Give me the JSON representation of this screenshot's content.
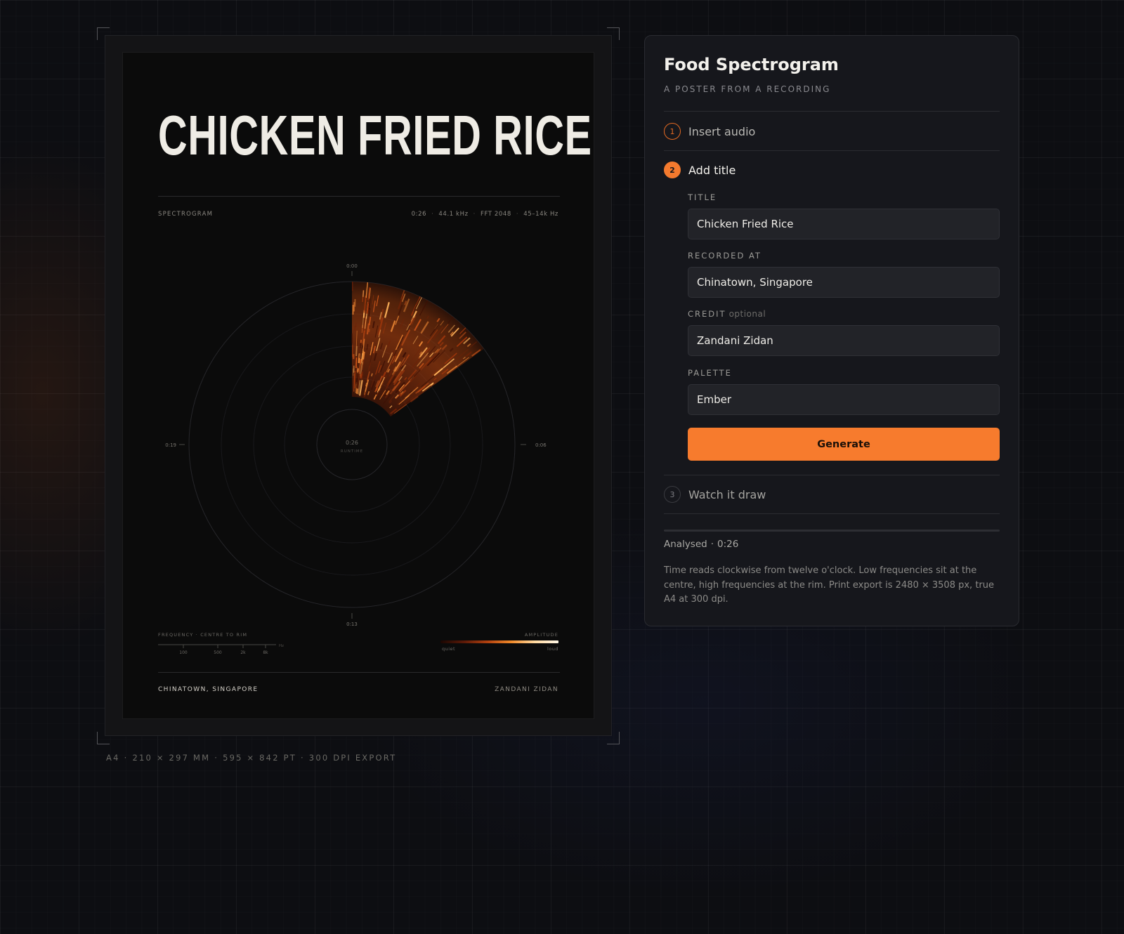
{
  "poster": {
    "title": "CHICKEN FRIED RICE",
    "spectrogram_label": "SPECTROGRAM",
    "stats": [
      "0:26",
      "44.1 kHz",
      "FFT 2048",
      "45–14k Hz"
    ],
    "time_marks": {
      "top": "0:00",
      "right": "0:06",
      "bottom": "0:13",
      "left": "0:19"
    },
    "center_time": "0:26",
    "center_label": "RUNTIME",
    "frequency_label": "FREQUENCY · CENTRE TO RIM",
    "frequency_ticks": [
      "100",
      "500",
      "2k",
      "8k"
    ],
    "frequency_unit": "Hz",
    "amplitude_label": "AMPLITUDE",
    "amplitude_quiet": "quiet",
    "amplitude_loud": "loud",
    "location": "CHINATOWN, SINGAPORE",
    "credit": "ZANDANI ZIDAN",
    "drawn_fraction": 0.15
  },
  "format_note": [
    "A4",
    "210 × 297 MM",
    "595 × 842 PT",
    "300 DPI EXPORT"
  ],
  "panel": {
    "title": "Food Spectrogram",
    "subtitle": "A POSTER FROM A RECORDING",
    "steps": [
      {
        "num": "1",
        "label": "Insert audio"
      },
      {
        "num": "2",
        "label": "Add title"
      },
      {
        "num": "3",
        "label": "Watch it draw"
      }
    ],
    "fields": {
      "title": {
        "label": "TITLE",
        "value": "Chicken Fried Rice"
      },
      "recorded_at": {
        "label": "RECORDED AT",
        "value": "Chinatown, Singapore"
      },
      "credit": {
        "label": "CREDIT",
        "optional": "optional",
        "value": "Zandani Zidan"
      },
      "palette": {
        "label": "PALETTE",
        "value": "Ember"
      }
    },
    "generate_label": "Generate",
    "progress": 0,
    "analysed_label": "Analysed",
    "analysed_time": "0:26",
    "note": "Time reads clockwise from twelve o'clock. Low frequencies sit at the centre, high frequencies at the rim. Print export is 2480 × 3508 px, true A4 at 300 dpi."
  },
  "colors": {
    "accent": "#f77b2d",
    "ember_dark": "#5c1a08",
    "ember_mid": "#c2470f",
    "ember_hot": "#ffb35a"
  }
}
